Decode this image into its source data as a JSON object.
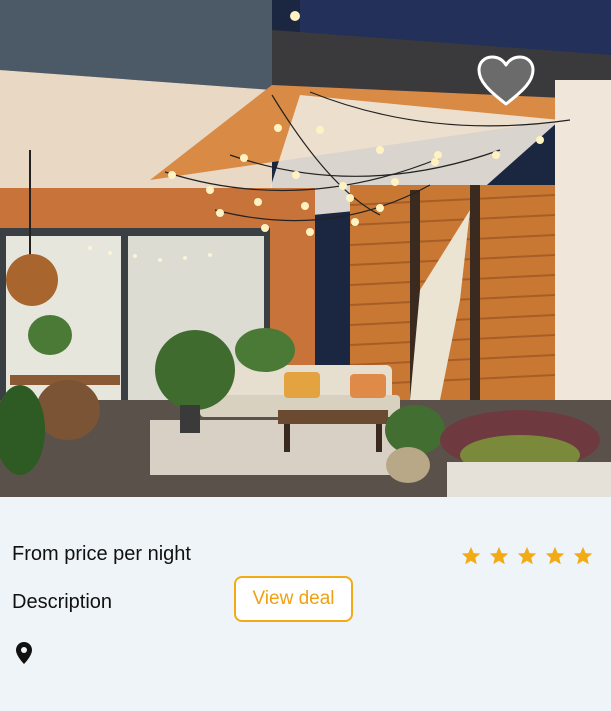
{
  "listing": {
    "price_label": "From price per night",
    "description_label": "Description",
    "view_deal_label": "View deal",
    "rating_stars": 5,
    "location_icon": "map-pin-icon",
    "favorite_icon": "heart-icon"
  },
  "colors": {
    "accent": "#f2ab14",
    "background": "#eef4f8",
    "heart_fill": "#6b6b6b"
  }
}
